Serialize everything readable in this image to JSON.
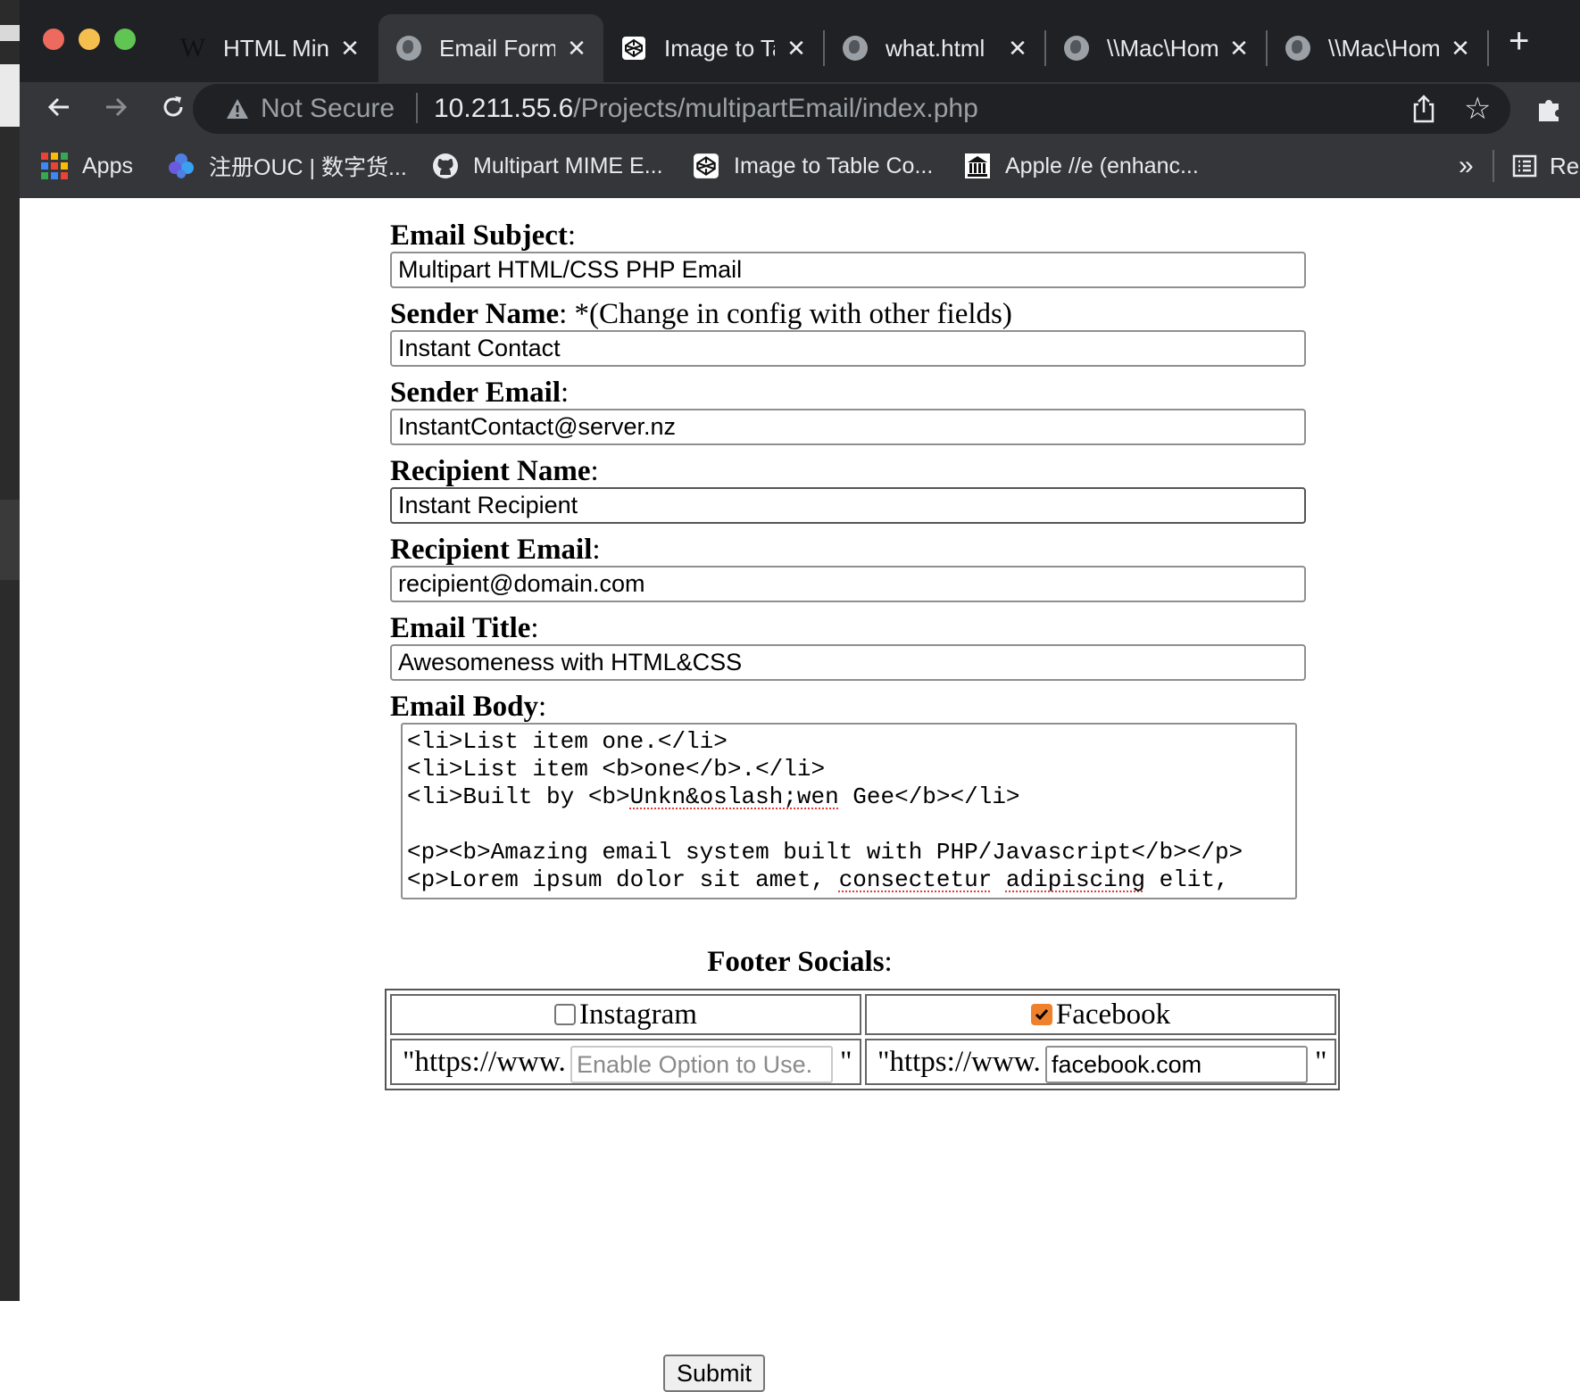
{
  "browser": {
    "tabs": [
      {
        "title": "HTML Mini",
        "favicon": "wikipedia-icon",
        "active": false
      },
      {
        "title": "Email Form",
        "favicon": "globe-icon",
        "active": true
      },
      {
        "title": "Image to Ta",
        "favicon": "codepen-icon",
        "active": false
      },
      {
        "title": "what.html",
        "favicon": "globe-icon",
        "active": false
      },
      {
        "title": "\\\\Mac\\Hom",
        "favicon": "globe-icon",
        "active": false
      },
      {
        "title": "\\\\Mac\\Hom",
        "favicon": "globe-icon",
        "active": false
      }
    ],
    "close_glyph": "✕",
    "new_tab_glyph": "+",
    "address": {
      "security": "Not Secure",
      "host": "10.211.55.6",
      "path": "/Projects/multipartEmail/index.php"
    },
    "bookmarks": [
      {
        "label": "Apps",
        "icon": "apps-grid-icon"
      },
      {
        "label": "注册OUC | 数字货...",
        "icon": "ouc-icon"
      },
      {
        "label": "Multipart MIME E...",
        "icon": "github-icon"
      },
      {
        "label": "Image to Table Co...",
        "icon": "codepen-icon"
      },
      {
        "label": "Apple //e (enhanc...",
        "icon": "museum-icon"
      }
    ],
    "bookmarks_more": "»",
    "reading_list_label": "Re"
  },
  "form": {
    "fields": [
      {
        "label": "Email Subject",
        "note": "",
        "value": "Multipart HTML/CSS PHP Email"
      },
      {
        "label": "Sender Name",
        "note": " *(Change in config with other fields)",
        "value": "Instant Contact"
      },
      {
        "label": "Sender Email",
        "note": "",
        "value": "InstantContact@server.nz"
      },
      {
        "label": "Recipient Name",
        "note": "",
        "value": "Instant Recipient"
      },
      {
        "label": "Recipient Email",
        "note": "",
        "value": "recipient@domain.com"
      },
      {
        "label": "Email Title",
        "note": "",
        "value": "Awesomeness with HTML&CSS"
      }
    ],
    "body_label": "Email Body",
    "body_lines": {
      "l1": "<li>List item one.</li>",
      "l2": "<li>List item <b>one</b>.</li>",
      "l3a": "<li>Built by <b>",
      "l3b": "Unkn&oslash;wen",
      "l3c": " Gee</b></li>",
      "l5": "<p><b>Amazing email system built with PHP/Javascript</b></p>",
      "l6a": "<p>Lorem ipsum dolor sit amet, ",
      "l6b": "consectetur",
      "l6c": " ",
      "l6d": "adipiscing",
      "l6e": " elit,"
    },
    "socials_label": "Footer Socials",
    "socials": [
      {
        "name": "Instagram",
        "checked": false,
        "prefix": "\"https://www.",
        "value": "",
        "placeholder": "Enable Option to Use.",
        "suffix": "\""
      },
      {
        "name": "Facebook",
        "checked": true,
        "prefix": "\"https://www.",
        "value": "facebook.com",
        "placeholder": "",
        "suffix": "\""
      }
    ],
    "submit_label": "Submit"
  },
  "colors": {
    "accent_checkbox": "#f0812c",
    "spellcheck_underline": "#e53935",
    "chrome_dark": "#202124",
    "chrome_toolbar": "#35363a"
  }
}
